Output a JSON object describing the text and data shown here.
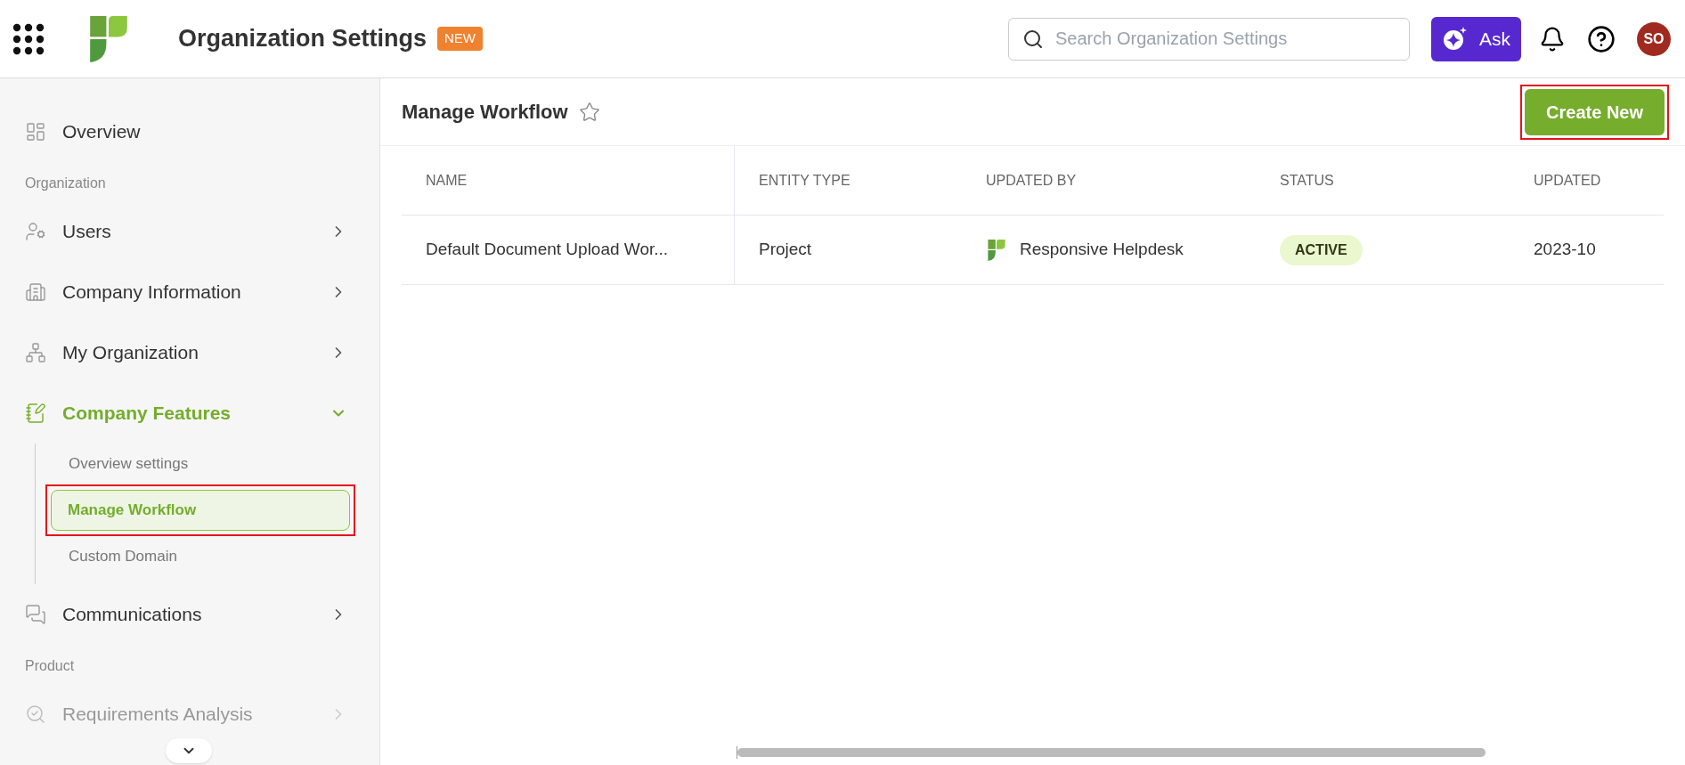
{
  "header": {
    "title": "Organization Settings",
    "badge": "NEW",
    "search": {
      "placeholder": "Search Organization Settings"
    },
    "ask_button": "Ask",
    "avatar": "SO"
  },
  "sidebar": {
    "items": [
      {
        "kind": "link",
        "label": "Overview"
      },
      {
        "kind": "heading",
        "label": "Organization"
      },
      {
        "kind": "group",
        "label": "Users",
        "expanded": false
      },
      {
        "kind": "group",
        "label": "Company Information",
        "expanded": false
      },
      {
        "kind": "group",
        "label": "My Organization",
        "expanded": false
      },
      {
        "kind": "group",
        "label": "Company Features",
        "expanded": true,
        "children": [
          {
            "label": "Overview settings",
            "selected": false,
            "highlighted": false
          },
          {
            "label": "Manage Workflow",
            "selected": true,
            "highlighted": true
          },
          {
            "label": "Custom Domain",
            "selected": false,
            "highlighted": false
          }
        ]
      },
      {
        "kind": "group",
        "label": "Communications",
        "expanded": false
      },
      {
        "kind": "heading",
        "label": "Product"
      },
      {
        "kind": "group",
        "label": "Requirements Analysis",
        "expanded": false,
        "dimmed": true
      }
    ]
  },
  "page": {
    "title": "Manage Workflow",
    "favorite": false,
    "create_button": {
      "label": "Create New",
      "highlighted": true
    }
  },
  "table": {
    "columns": [
      "NAME",
      "ENTITY TYPE",
      "UPDATED BY",
      "STATUS",
      "UPDATED"
    ],
    "rows": [
      {
        "name": "Default Document Upload Wor...",
        "entity_type": "Project",
        "updated_by": "Responsive Helpdesk",
        "status": "ACTIVE",
        "updated": "2023-10"
      }
    ]
  }
}
